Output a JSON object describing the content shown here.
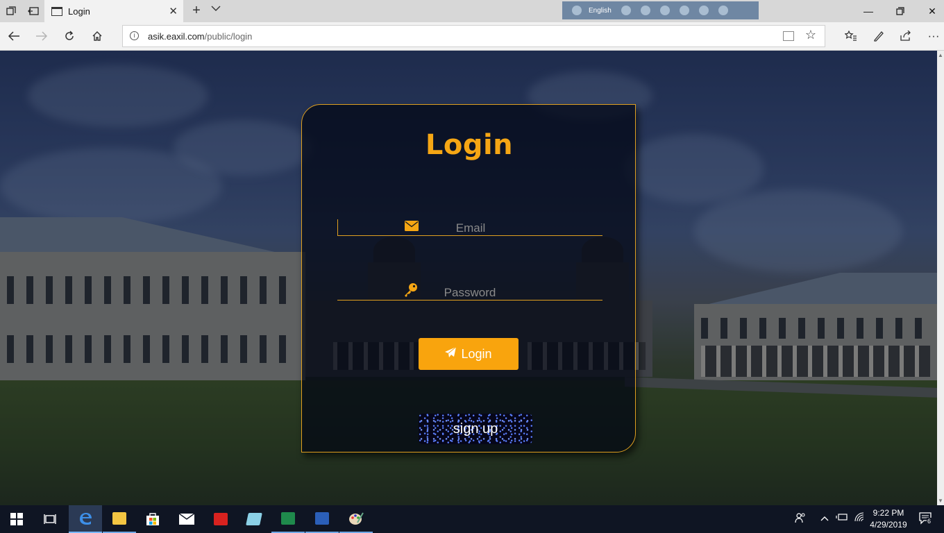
{
  "browser": {
    "tab_title": "Login",
    "url_host": "asik.eaxil.com",
    "url_path": "/public/login",
    "language_bar_label": "English"
  },
  "login_form": {
    "title": "Login",
    "email_placeholder": "Email",
    "password_placeholder": "Password",
    "login_button_label": "Login",
    "signup_button_label": "sign up"
  },
  "taskbar": {
    "time": "9:22 PM",
    "date": "4/29/2019",
    "notification_count": "6"
  },
  "colors": {
    "accent": "#f5a614",
    "card_border": "#e0a020"
  }
}
